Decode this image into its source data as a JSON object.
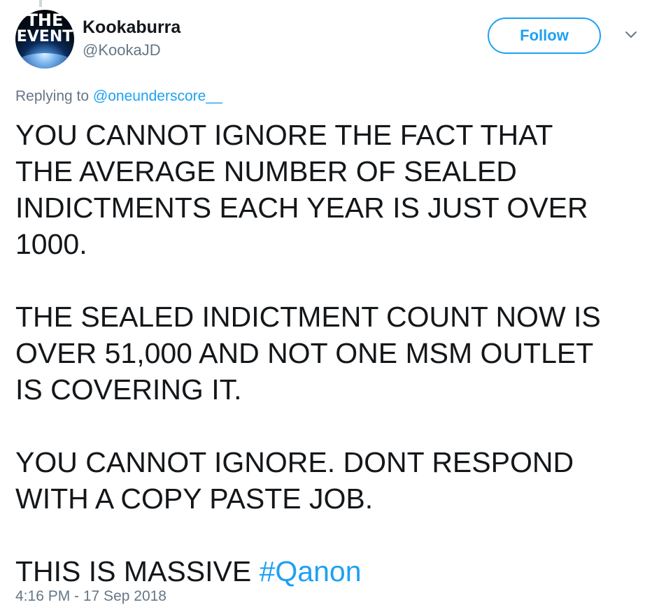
{
  "author": {
    "display_name": "Kookaburra",
    "handle": "@KookaJD",
    "avatar": {
      "line1": "THE",
      "line2": "EVENT"
    }
  },
  "actions": {
    "follow_label": "Follow",
    "more_icon": "chevron-down-icon"
  },
  "reply_context": {
    "prefix": "Replying to ",
    "mention": "@oneunderscore__"
  },
  "tweet": {
    "paragraphs": [
      "YOU CANNOT IGNORE THE FACT THAT\nTHE AVERAGE NUMBER OF SEALED\nINDICTMENTS EACH YEAR IS JUST OVER\n1000.",
      "THE SEALED INDICTMENT COUNT NOW IS\nOVER 51,000 AND NOT ONE MSM OUTLET\nIS COVERING IT.",
      "YOU CANNOT IGNORE. DONT RESPOND\nWITH A COPY PASTE JOB."
    ],
    "last_line_text": "THIS IS MASSIVE ",
    "hashtag": "#Qanon"
  },
  "timestamp": "4:16 PM - 17 Sep 2018",
  "colors": {
    "accent": "#1da1f2",
    "text": "#14171a",
    "secondary": "#657786"
  }
}
